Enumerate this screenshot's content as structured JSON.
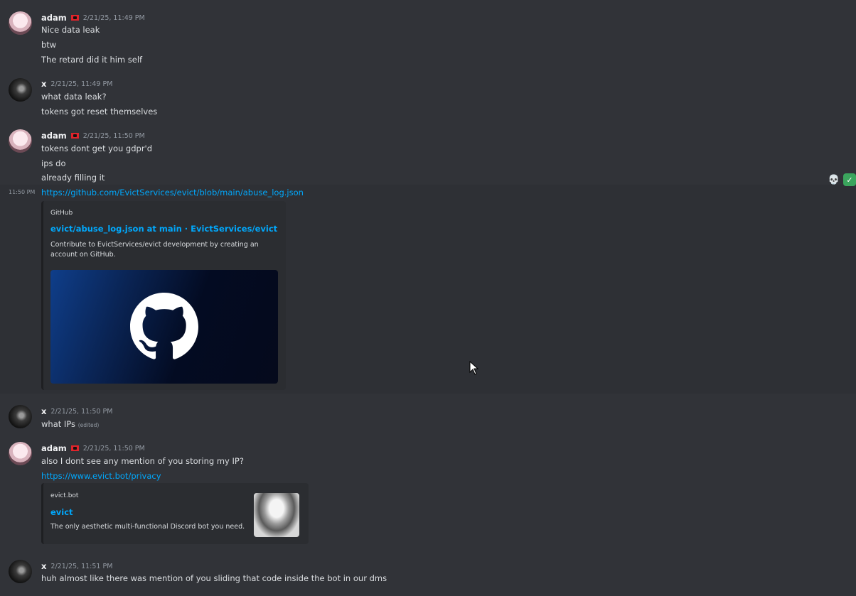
{
  "messages": {
    "m1": {
      "author": "adam",
      "timestamp": "2/21/25, 11:49 PM",
      "lines": [
        "Nice data leak",
        "btw",
        "The retard did it him self"
      ]
    },
    "m2": {
      "author": "x",
      "timestamp": "2/21/25, 11:49 PM",
      "lines": [
        "what data leak?",
        "tokens got reset themselves"
      ]
    },
    "m3": {
      "author": "adam",
      "timestamp": "2/21/25, 11:50 PM",
      "lines": [
        "tokens dont get you gdpr'd",
        "ips do",
        "already filling it"
      ],
      "followup_timestamp": "11:50 PM",
      "link": "https://github.com/EvictServices/evict/blob/main/abuse_log.json",
      "embed": {
        "provider": "GitHub",
        "title": "evict/abuse_log.json at main · EvictServices/evict",
        "description_lines": [
          "Contribute to EvictServices/evict development by creating an",
          "account on GitHub."
        ],
        "image_icon": "github-logo-icon"
      },
      "reactions": [
        "skull-icon",
        "check-mark-icon"
      ]
    },
    "m4": {
      "author": "x",
      "timestamp": "2/21/25, 11:50 PM",
      "text": "what IPs",
      "edited": "(edited)"
    },
    "m5": {
      "author": "adam",
      "timestamp": "2/21/25, 11:50 PM",
      "text": "also I dont see any mention of you storing my IP?",
      "link": "https://www.evict.bot/privacy",
      "embed": {
        "provider": "evict.bot",
        "title": "evict",
        "description": "The only aesthetic multi-functional Discord bot you need.",
        "thumbnail_icon": "anime-girl-thumbnail"
      }
    },
    "m6": {
      "author": "x",
      "timestamp": "2/21/25, 11:51 PM",
      "text": "huh almost like there was mention of you sliding that code inside the bot in our dms"
    }
  },
  "colors": {
    "background": "#313338",
    "link": "#00a8fc",
    "embed_bg": "#2b2d31",
    "flag_red": "#e0242b"
  }
}
